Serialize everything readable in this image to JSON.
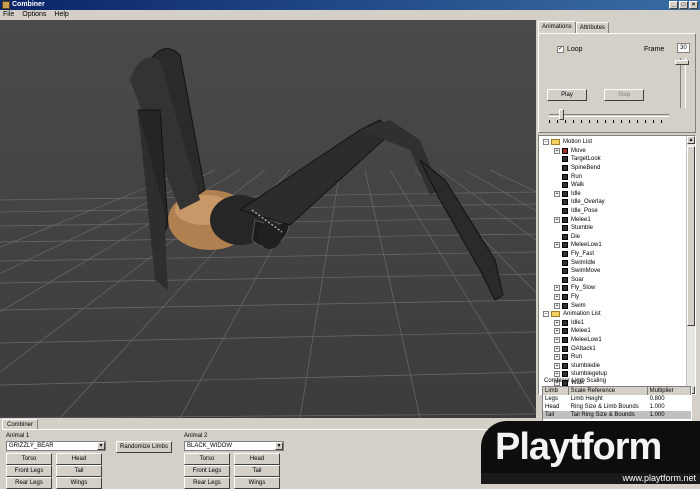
{
  "window": {
    "title": "Combiner",
    "minimize": "_",
    "maximize": "□",
    "close": "×"
  },
  "menu": [
    "File",
    "Options",
    "Help"
  ],
  "tabs": {
    "animations": "Animations",
    "attributes": "Attributes"
  },
  "anim_panel": {
    "loop_label": "Loop",
    "loop_checked": true,
    "loop_mark": "✓",
    "frame_label": "Frame",
    "frame_value": "30",
    "play_label": "Play",
    "stop_label": "Stop"
  },
  "tree": {
    "motion_list": {
      "label": "Motion List",
      "items": [
        {
          "label": "Move",
          "expandable": true,
          "red": true
        },
        {
          "label": "TargetLook",
          "expandable": false
        },
        {
          "label": "SpineBend",
          "expandable": false
        },
        {
          "label": "Run",
          "expandable": false
        },
        {
          "label": "Walk",
          "expandable": false
        },
        {
          "label": "Idle",
          "expandable": true
        },
        {
          "label": "Idle_Overlay",
          "expandable": false
        },
        {
          "label": "Idle_Pose",
          "expandable": false
        },
        {
          "label": "Melee1",
          "expandable": true
        },
        {
          "label": "Stumble",
          "expandable": false
        },
        {
          "label": "Die",
          "expandable": false
        },
        {
          "label": "MeleeLow1",
          "expandable": true
        },
        {
          "label": "Fly_Fast",
          "expandable": false
        },
        {
          "label": "SwimIdle",
          "expandable": false
        },
        {
          "label": "SwimMove",
          "expandable": false
        },
        {
          "label": "Soar",
          "expandable": false
        },
        {
          "label": "Fly_Slow",
          "expandable": true
        },
        {
          "label": "Fly",
          "expandable": true
        },
        {
          "label": "Swim",
          "expandable": true
        }
      ]
    },
    "animation_list": {
      "label": "Animation List",
      "items": [
        {
          "label": "Idle1",
          "expandable": true
        },
        {
          "label": "Melee1",
          "expandable": true
        },
        {
          "label": "MeleeLow1",
          "expandable": true
        },
        {
          "label": "OAttack1",
          "expandable": true
        },
        {
          "label": "Run",
          "expandable": true
        },
        {
          "label": "stumbledie",
          "expandable": true
        },
        {
          "label": "stumblegetup",
          "expandable": true
        },
        {
          "label": "Walk",
          "expandable": true
        }
      ]
    }
  },
  "limb_scaling": {
    "title": "Combiner Limb Scaling",
    "headers": [
      "Limb",
      "Scale Reference",
      "Multiplier"
    ],
    "rows": [
      [
        "Legs",
        "Limb Height",
        "0.800"
      ],
      [
        "Head",
        "Ring Size & Limb Bounds",
        "1.000"
      ],
      [
        "Tail",
        "Tail Ring Size & Bounds",
        "1.000"
      ]
    ]
  },
  "bottom": {
    "tab_label": "Combiner",
    "animal1": {
      "label": "Animal 1",
      "value": "GRIZZLY_BEAR",
      "buttons": [
        "Torso",
        "Head",
        "Front Legs",
        "Tail",
        "Rear Legs",
        "Wings"
      ]
    },
    "randomize_label": "Randomize Limbs",
    "animal2": {
      "label": "Animal 2",
      "value": "BLACK_WIDOW",
      "buttons": [
        "Torso",
        "Head",
        "Front Legs",
        "Tail",
        "Rear Legs",
        "Wings"
      ]
    }
  },
  "watermark": {
    "brand": "Playtform",
    "url": "www.playtform.net"
  },
  "colors": {
    "viewport_bg": "#474747",
    "creature_body": "#2a2a2a",
    "creature_fur": "#b08050",
    "title_bar": "#0a246a"
  }
}
